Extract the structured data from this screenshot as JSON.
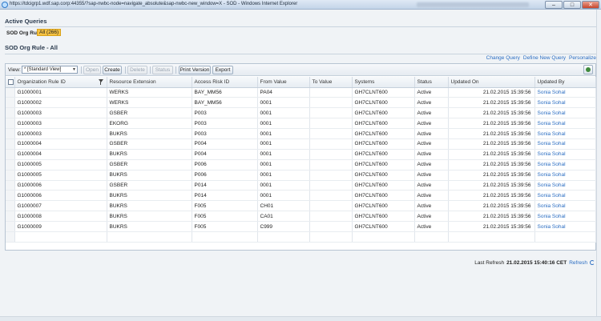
{
  "window": {
    "title": "https://tdcigrp1.wdf.sap.corp:44355/?sap-nwbc-node=navigate_absolute&sap-nwbc-new_window=X - SOD - Windows Internet Explorer",
    "buttons": {
      "minimize": "–",
      "maximize": "□",
      "close": "✕"
    }
  },
  "active_queries": {
    "heading": "Active Queries",
    "rule_label": "SOD Org Rule",
    "rule_badge": "All (266)"
  },
  "view_title": "SOD Org Rule - All",
  "top_links": {
    "change_query": "Change Query",
    "define_query": "Define New Query",
    "personalize": "Personalize"
  },
  "toolbar": {
    "view_label": "View:",
    "view_value": "* [Standard View]",
    "open": "Open",
    "create": "Create",
    "delete": "Delete",
    "status": "Status",
    "print_version": "Print Version",
    "export": "Export"
  },
  "table": {
    "columns": [
      "Organization Rule ID",
      "Resource Extension",
      "Access Risk ID",
      "From Value",
      "To Value",
      "Systems",
      "Status",
      "Updated On",
      "Updated By"
    ],
    "rows": [
      [
        "G1000001",
        "WERKS",
        "BAY_MM56",
        "PA04",
        "",
        "GH7CLNT600",
        "Active",
        "21.02.2015 15:39:56",
        "Sonia Sohal"
      ],
      [
        "G1000002",
        "WERKS",
        "BAY_MM56",
        "0001",
        "",
        "GH7CLNT600",
        "Active",
        "21.02.2015 15:39:56",
        "Sonia Sohal"
      ],
      [
        "G1000003",
        "GSBER",
        "P003",
        "0001",
        "",
        "GH7CLNT600",
        "Active",
        "21.02.2015 15:39:56",
        "Sonia Sohal"
      ],
      [
        "G1000003",
        "EKORG",
        "P003",
        "0001",
        "",
        "GH7CLNT600",
        "Active",
        "21.02.2015 15:39:56",
        "Sonia Sohal"
      ],
      [
        "G1000003",
        "BUKRS",
        "P003",
        "0001",
        "",
        "GH7CLNT600",
        "Active",
        "21.02.2015 15:39:56",
        "Sonia Sohal"
      ],
      [
        "G1000004",
        "GSBER",
        "P004",
        "0001",
        "",
        "GH7CLNT600",
        "Active",
        "21.02.2015 15:39:56",
        "Sonia Sohal"
      ],
      [
        "G1000004",
        "BUKRS",
        "P004",
        "0001",
        "",
        "GH7CLNT600",
        "Active",
        "21.02.2015 15:39:56",
        "Sonia Sohal"
      ],
      [
        "G1000005",
        "GSBER",
        "P006",
        "0001",
        "",
        "GH7CLNT600",
        "Active",
        "21.02.2015 15:39:56",
        "Sonia Sohal"
      ],
      [
        "G1000005",
        "BUKRS",
        "P006",
        "0001",
        "",
        "GH7CLNT600",
        "Active",
        "21.02.2015 15:39:56",
        "Sonia Sohal"
      ],
      [
        "G1000006",
        "GSBER",
        "P014",
        "0001",
        "",
        "GH7CLNT600",
        "Active",
        "21.02.2015 15:39:56",
        "Sonia Sohal"
      ],
      [
        "G1000006",
        "BUKRS",
        "P014",
        "0001",
        "",
        "GH7CLNT600",
        "Active",
        "21.02.2015 15:39:56",
        "Sonia Sohal"
      ],
      [
        "G1000007",
        "BUKRS",
        "F005",
        "CH01",
        "",
        "GH7CLNT600",
        "Active",
        "21.02.2015 15:39:56",
        "Sonia Sohal"
      ],
      [
        "G1000008",
        "BUKRS",
        "F005",
        "CA01",
        "",
        "GH7CLNT600",
        "Active",
        "21.02.2015 15:39:56",
        "Sonia Sohal"
      ],
      [
        "G1000009",
        "BUKRS",
        "F005",
        "C999",
        "",
        "GH7CLNT600",
        "Active",
        "21.02.2015 15:39:56",
        "Sonia Sohal"
      ]
    ],
    "empty_rows": 1
  },
  "footer": {
    "last_refresh_label": "Last Refresh",
    "timestamp": "21.02.2015 15:40:16 CET",
    "refresh": "Refresh"
  },
  "colors": {
    "link": "#2a6dc2",
    "badge": "#f5c242"
  }
}
